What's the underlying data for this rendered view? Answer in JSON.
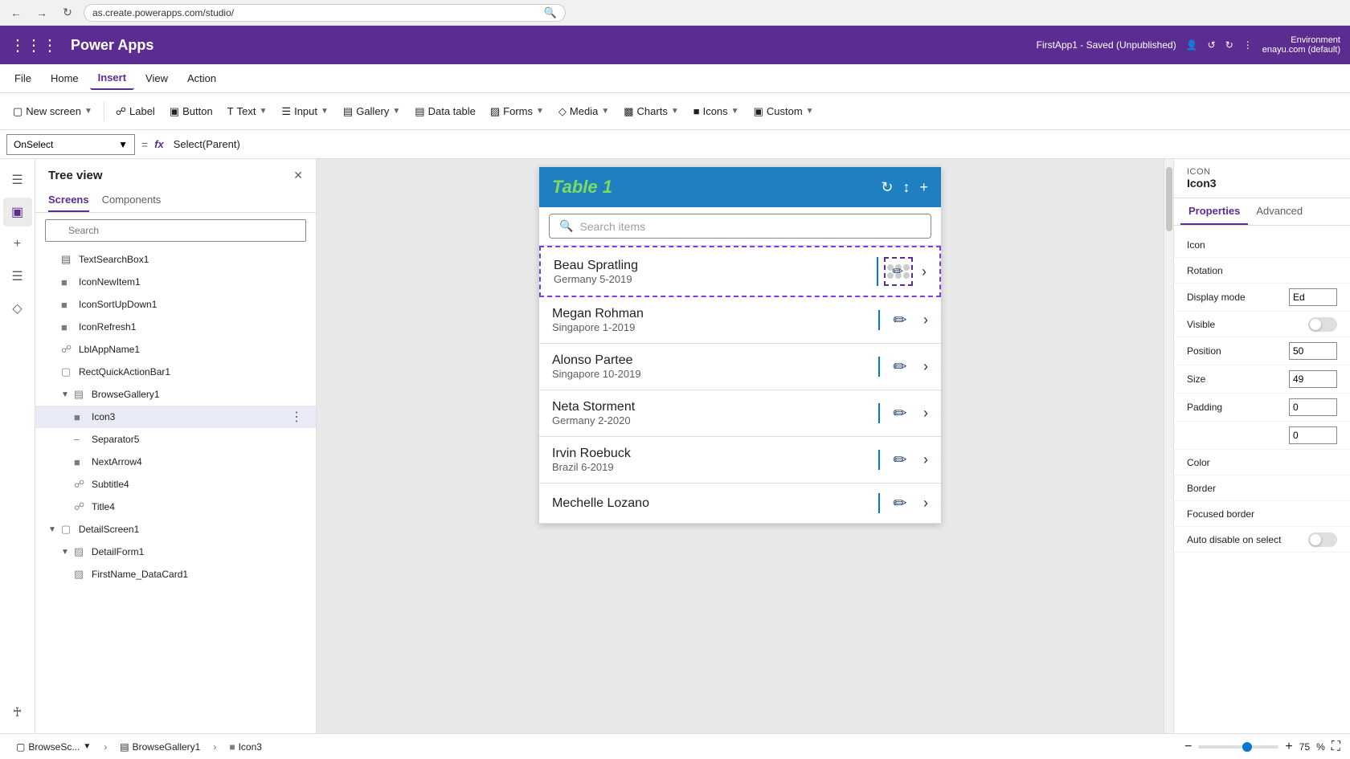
{
  "browser": {
    "url": "as.create.powerapps.com/studio/",
    "back_title": "Back",
    "forward_title": "Forward",
    "refresh_title": "Refresh"
  },
  "titlebar": {
    "app_name": "Power Apps",
    "environment_label": "Environment",
    "environment_value": "enayu.com (default)",
    "saved_status": "FirstApp1 - Saved (Unpublished)"
  },
  "menubar": {
    "items": [
      "File",
      "Home",
      "Insert",
      "View",
      "Action"
    ],
    "active_item": "Insert"
  },
  "toolbar": {
    "new_screen": "New screen",
    "label": "Label",
    "button": "Button",
    "text": "Text",
    "input": "Input",
    "gallery": "Gallery",
    "data_table": "Data table",
    "forms": "Forms",
    "media": "Media",
    "charts": "Charts",
    "icons": "Icons",
    "custom": "Custom"
  },
  "formula_bar": {
    "property": "OnSelect",
    "formula": "Select(Parent)"
  },
  "left_panel": {
    "title": "Tree view",
    "tabs": [
      "Screens",
      "Components"
    ],
    "active_tab": "Screens",
    "search_placeholder": "Search",
    "items": [
      {
        "id": "TextSearchBox1",
        "label": "TextSearchBox1",
        "indent": 1,
        "icon": "textbox"
      },
      {
        "id": "IconNewItem1",
        "label": "IconNewItem1",
        "indent": 1,
        "icon": "icon"
      },
      {
        "id": "IconSortUpDown1",
        "label": "IconSortUpDown1",
        "indent": 1,
        "icon": "icon"
      },
      {
        "id": "IconRefresh1",
        "label": "IconRefresh1",
        "indent": 1,
        "icon": "icon"
      },
      {
        "id": "LblAppName1",
        "label": "LblAppName1",
        "indent": 1,
        "icon": "label"
      },
      {
        "id": "RectQuickActionBar1",
        "label": "RectQuickActionBar1",
        "indent": 1,
        "icon": "rect"
      },
      {
        "id": "BrowseGallery1",
        "label": "BrowseGallery1",
        "indent": 1,
        "icon": "gallery",
        "expanded": true
      },
      {
        "id": "Icon3",
        "label": "Icon3",
        "indent": 2,
        "icon": "icon",
        "selected": true,
        "has_dots": true
      },
      {
        "id": "Separator5",
        "label": "Separator5",
        "indent": 2,
        "icon": "separator"
      },
      {
        "id": "NextArrow4",
        "label": "NextArrow4",
        "indent": 2,
        "icon": "icon"
      },
      {
        "id": "Subtitle4",
        "label": "Subtitle4",
        "indent": 2,
        "icon": "label"
      },
      {
        "id": "Title4",
        "label": "Title4",
        "indent": 2,
        "icon": "label"
      },
      {
        "id": "DetailScreen1",
        "label": "DetailScreen1",
        "indent": 0,
        "icon": "screen",
        "expanded": true
      },
      {
        "id": "DetailForm1",
        "label": "DetailForm1",
        "indent": 1,
        "icon": "form",
        "expanded": true
      },
      {
        "id": "FirstName_DataCard1",
        "label": "FirstName_DataCard1",
        "indent": 2,
        "icon": "form"
      }
    ]
  },
  "right_panel": {
    "icon_section": "ICON",
    "icon_name": "Icon3",
    "tabs": [
      "Properties",
      "Advanced"
    ],
    "active_tab": "Properties",
    "properties": [
      {
        "label": "Icon",
        "value": ""
      },
      {
        "label": "Rotation",
        "value": ""
      },
      {
        "label": "Display mode",
        "value": "Ed"
      },
      {
        "label": "Visible",
        "value": ""
      },
      {
        "label": "Position",
        "value": "50"
      },
      {
        "label": "Size",
        "value": "49"
      },
      {
        "label": "Padding",
        "value": "0"
      },
      {
        "label": "",
        "value": "0"
      },
      {
        "label": "Color",
        "value": ""
      },
      {
        "label": "Border",
        "value": ""
      },
      {
        "label": "Focused border",
        "value": ""
      },
      {
        "label": "Auto disable on select",
        "value": ""
      }
    ]
  },
  "canvas": {
    "app_title": "Table 1",
    "search_placeholder": "Search items",
    "gallery_items": [
      {
        "name": "Beau Spratling",
        "subtitle": "Germany 5-2019",
        "selected": true
      },
      {
        "name": "Megan Rohman",
        "subtitle": "Singapore 1-2019"
      },
      {
        "name": "Alonso Partee",
        "subtitle": "Singapore 10-2019"
      },
      {
        "name": "Neta Storment",
        "subtitle": "Germany 2-2020"
      },
      {
        "name": "Irvin Roebuck",
        "subtitle": "Brazil 6-2019"
      },
      {
        "name": "Mechelle Lozano",
        "subtitle": ""
      }
    ]
  },
  "status_bar": {
    "browse_screen": "BrowseSc...",
    "gallery": "BrowseGallery1",
    "icon": "Icon3",
    "zoom_minus": "−",
    "zoom_plus": "+",
    "zoom_level": "75",
    "zoom_pct": "%",
    "fullscreen": "⛶"
  }
}
